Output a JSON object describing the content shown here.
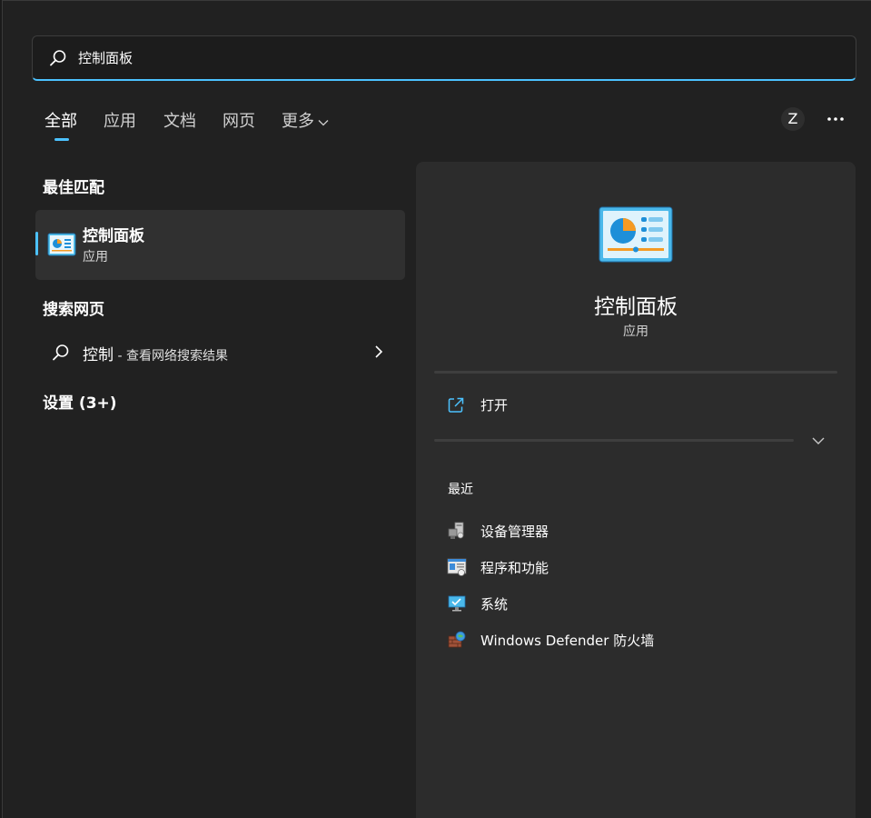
{
  "search": {
    "query": "控制面板"
  },
  "tabs": [
    {
      "label": "全部"
    },
    {
      "label": "应用"
    },
    {
      "label": "文档"
    },
    {
      "label": "网页"
    },
    {
      "label": "更多"
    }
  ],
  "account": {
    "initial": "Z"
  },
  "sections": {
    "best_match": "最佳匹配",
    "search_web": "搜索网页",
    "settings": "设置 (3+)"
  },
  "best_match": {
    "title": "控制面板",
    "subtitle": "应用"
  },
  "web_search": {
    "keyword": "控制",
    "suffix": " - 查看网络搜索结果"
  },
  "detail": {
    "name": "控制面板",
    "type": "应用",
    "open_label": "打开",
    "recent_title": "最近",
    "recent": [
      {
        "label": "设备管理器",
        "icon": "device-manager-icon"
      },
      {
        "label": "程序和功能",
        "icon": "programs-features-icon"
      },
      {
        "label": "系统",
        "icon": "system-icon"
      },
      {
        "label": "Windows Defender 防火墙",
        "icon": "firewall-icon"
      }
    ]
  },
  "colors": {
    "accent": "#4cc2ff",
    "background": "#212121",
    "panel": "#2c2c2c",
    "selected": "#303030"
  }
}
